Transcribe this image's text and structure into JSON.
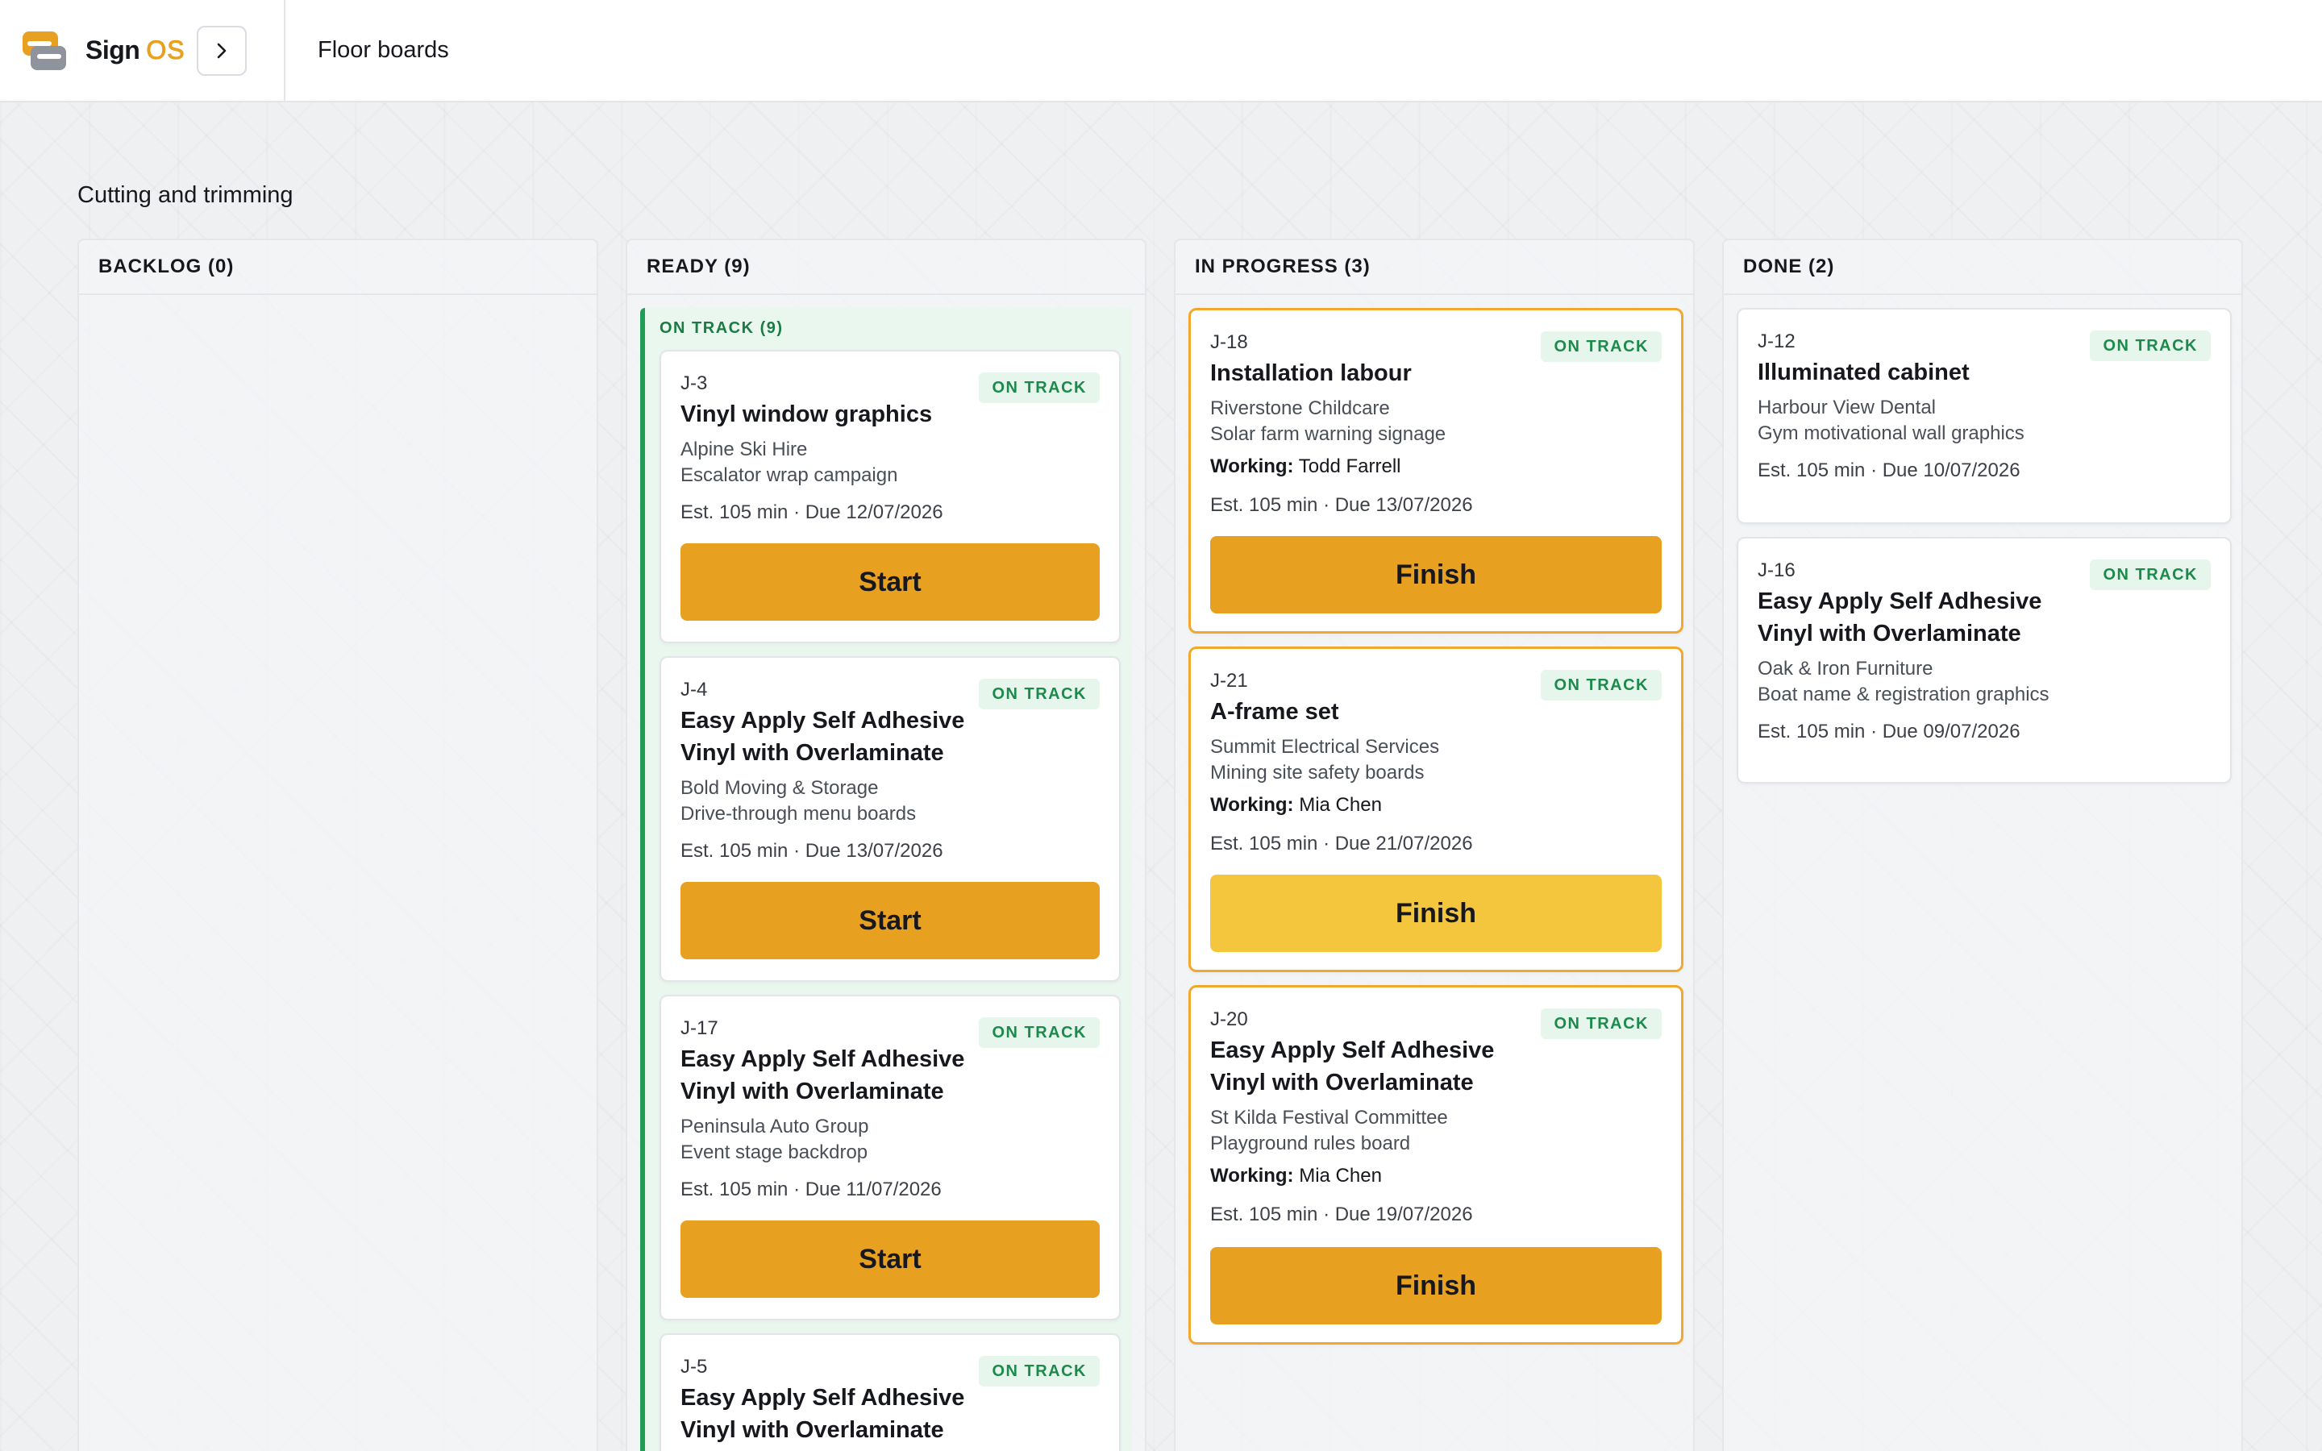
{
  "app": {
    "brand_name": "Sign",
    "brand_suffix": "OS",
    "page_title": "Floor boards"
  },
  "section": {
    "title": "Cutting and trimming"
  },
  "columns": [
    {
      "label": "BACKLOG (0)"
    },
    {
      "label": "READY (9)",
      "group_label": "ON TRACK (9)"
    },
    {
      "label": "IN PROGRESS (3)"
    },
    {
      "label": "DONE (2)"
    }
  ],
  "ready_cards": [
    {
      "id": "J-3",
      "title": "Vinyl window graphics",
      "customer": "Alpine Ski Hire",
      "project": "Escalator wrap campaign",
      "est": "Est. 105 min · Due 12/07/2026",
      "badge": "ON TRACK",
      "button": "Start"
    },
    {
      "id": "J-4",
      "title": "Easy Apply Self Adhesive Vinyl with Overlaminate",
      "customer": "Bold Moving & Storage",
      "project": "Drive-through menu boards",
      "est": "Est. 105 min · Due 13/07/2026",
      "badge": "ON TRACK",
      "button": "Start"
    },
    {
      "id": "J-17",
      "title": "Easy Apply Self Adhesive Vinyl with Overlaminate",
      "customer": "Peninsula Auto Group",
      "project": "Event stage backdrop",
      "est": "Est. 105 min · Due 11/07/2026",
      "badge": "ON TRACK",
      "button": "Start"
    },
    {
      "id": "J-5",
      "title": "Easy Apply Self Adhesive Vinyl with Overlaminate",
      "badge": "ON TRACK"
    }
  ],
  "progress_cards": [
    {
      "id": "J-18",
      "title": "Installation labour",
      "customer": "Riverstone Childcare",
      "project": "Solar farm warning signage",
      "worker_label": "Working:",
      "worker": "Todd Farrell",
      "est": "Est. 105 min · Due 13/07/2026",
      "badge": "ON TRACK",
      "button": "Finish"
    },
    {
      "id": "J-21",
      "title": "A-frame set",
      "customer": "Summit Electrical Services",
      "project": "Mining site safety boards",
      "worker_label": "Working:",
      "worker": "Mia Chen",
      "est": "Est. 105 min · Due 21/07/2026",
      "badge": "ON TRACK",
      "button": "Finish"
    },
    {
      "id": "J-20",
      "title": "Easy Apply Self Adhesive Vinyl with Overlaminate",
      "customer": "St Kilda Festival Committee",
      "project": "Playground rules board",
      "worker_label": "Working:",
      "worker": "Mia Chen",
      "est": "Est. 105 min · Due 19/07/2026",
      "badge": "ON TRACK",
      "button": "Finish"
    }
  ],
  "done_cards": [
    {
      "id": "J-12",
      "title": "Illuminated cabinet",
      "customer": "Harbour View Dental",
      "project": "Gym motivational wall graphics",
      "est": "Est. 105 min · Due 10/07/2026",
      "badge": "ON TRACK"
    },
    {
      "id": "J-16",
      "title": "Easy Apply Self Adhesive Vinyl with Overlaminate",
      "customer": "Oak & Iron Furniture",
      "project": "Boat name & registration graphics",
      "est": "Est. 105 min · Due 09/07/2026",
      "badge": "ON TRACK"
    }
  ],
  "colors": {
    "accent": "#e8a020",
    "accent_light": "#f3c63d",
    "on_track": "#1c8a4b",
    "active_border": "#f2a72e"
  },
  "icons": {
    "logo": "sign-os-logo",
    "collapse": "chevron-right-icon"
  }
}
